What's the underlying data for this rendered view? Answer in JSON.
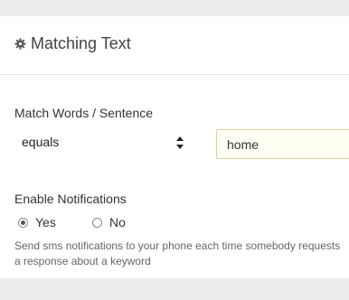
{
  "panel": {
    "title": "Matching Text",
    "title_icon": "gear-icon"
  },
  "match": {
    "label": "Match Words / Sentence",
    "select_value": "equals",
    "select_icon": "updown-arrows-icon",
    "input_value": "home"
  },
  "notifications": {
    "label": "Enable Notifications",
    "options": [
      {
        "label": "Yes",
        "checked": true
      },
      {
        "label": "No",
        "checked": false
      }
    ],
    "help_text": "Send sms notifications to your phone each time somebody requests a response about a keyword"
  },
  "colors": {
    "page_bg": "#ececec",
    "panel_bg": "#ffffff",
    "input_bg": "#fffef2",
    "input_border": "#d8d0a0"
  }
}
